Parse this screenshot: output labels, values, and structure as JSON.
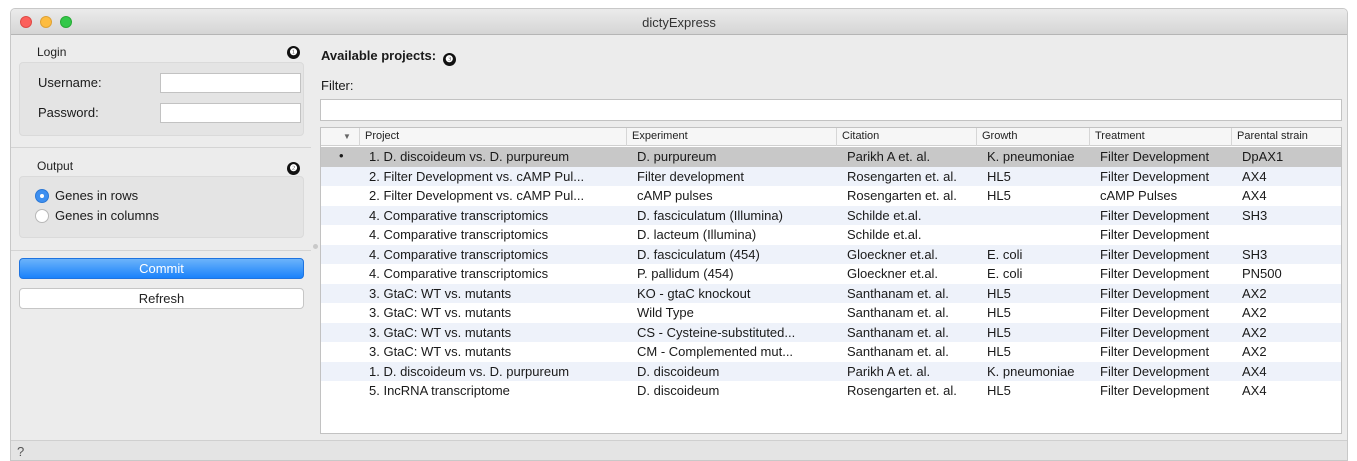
{
  "window": {
    "title": "dictyExpress"
  },
  "login": {
    "group_label": "Login",
    "username_label": "Username:",
    "username_value": "",
    "password_label": "Password:",
    "password_value": "",
    "badge": "❶"
  },
  "output": {
    "group_label": "Output",
    "badge": "❷",
    "options": [
      "Genes in rows",
      "Genes in columns"
    ],
    "selected": "Genes in rows"
  },
  "buttons": {
    "commit": "Commit",
    "refresh": "Refresh"
  },
  "projects": {
    "heading": "Available projects:",
    "badge": "❸",
    "filter_label": "Filter:",
    "filter_value": "",
    "sort_indicator": "▼",
    "columns": [
      "Project",
      "Experiment",
      "Citation",
      "Growth",
      "Treatment",
      "Parental strain"
    ],
    "rows": [
      [
        "1. D. discoideum vs. D. purpureum",
        "D. purpureum",
        "Parikh A et. al.",
        "K. pneumoniae",
        "Filter Development",
        "DpAX1"
      ],
      [
        "2. Filter Development vs. cAMP Pul...",
        "Filter development",
        "Rosengarten et. al.",
        "HL5",
        "Filter Development",
        "AX4"
      ],
      [
        "2. Filter Development vs. cAMP Pul...",
        "cAMP pulses",
        "Rosengarten et. al.",
        "HL5",
        "cAMP Pulses",
        "AX4"
      ],
      [
        "4. Comparative transcriptomics",
        "D. fasciculatum (Illumina)",
        "Schilde et.al.",
        "",
        "Filter Development",
        "SH3"
      ],
      [
        "4. Comparative transcriptomics",
        "D. lacteum (Illumina)",
        "Schilde et.al.",
        "",
        "Filter Development",
        ""
      ],
      [
        "4. Comparative transcriptomics",
        "D. fasciculatum (454)",
        "Gloeckner et.al.",
        "E. coli",
        "Filter Development",
        "SH3"
      ],
      [
        "4. Comparative transcriptomics",
        "P. pallidum (454)",
        "Gloeckner et.al.",
        "E. coli",
        "Filter Development",
        "PN500"
      ],
      [
        "3. GtaC: WT vs. mutants",
        "KO - gtaC knockout",
        "Santhanam et. al.",
        "HL5",
        "Filter Development",
        "AX2"
      ],
      [
        "3. GtaC: WT vs. mutants",
        "Wild Type",
        "Santhanam et. al.",
        "HL5",
        "Filter Development",
        "AX2"
      ],
      [
        "3. GtaC: WT vs. mutants",
        "CS - Cysteine-substituted...",
        "Santhanam et. al.",
        "HL5",
        "Filter Development",
        "AX2"
      ],
      [
        "3. GtaC: WT vs. mutants",
        "CM - Complemented mut...",
        "Santhanam et. al.",
        "HL5",
        "Filter Development",
        "AX2"
      ],
      [
        "1. D. discoideum vs. D. purpureum",
        "D. discoideum",
        "Parikh A et. al.",
        "K. pneumoniae",
        "Filter Development",
        "AX4"
      ],
      [
        "5. IncRNA transcriptome",
        "D. discoideum",
        "Rosengarten et. al.",
        "HL5",
        "Filter Development",
        "AX4"
      ]
    ],
    "selected_row": 0,
    "selected_marker": "•"
  },
  "statusbar": {
    "help_icon": "?"
  }
}
